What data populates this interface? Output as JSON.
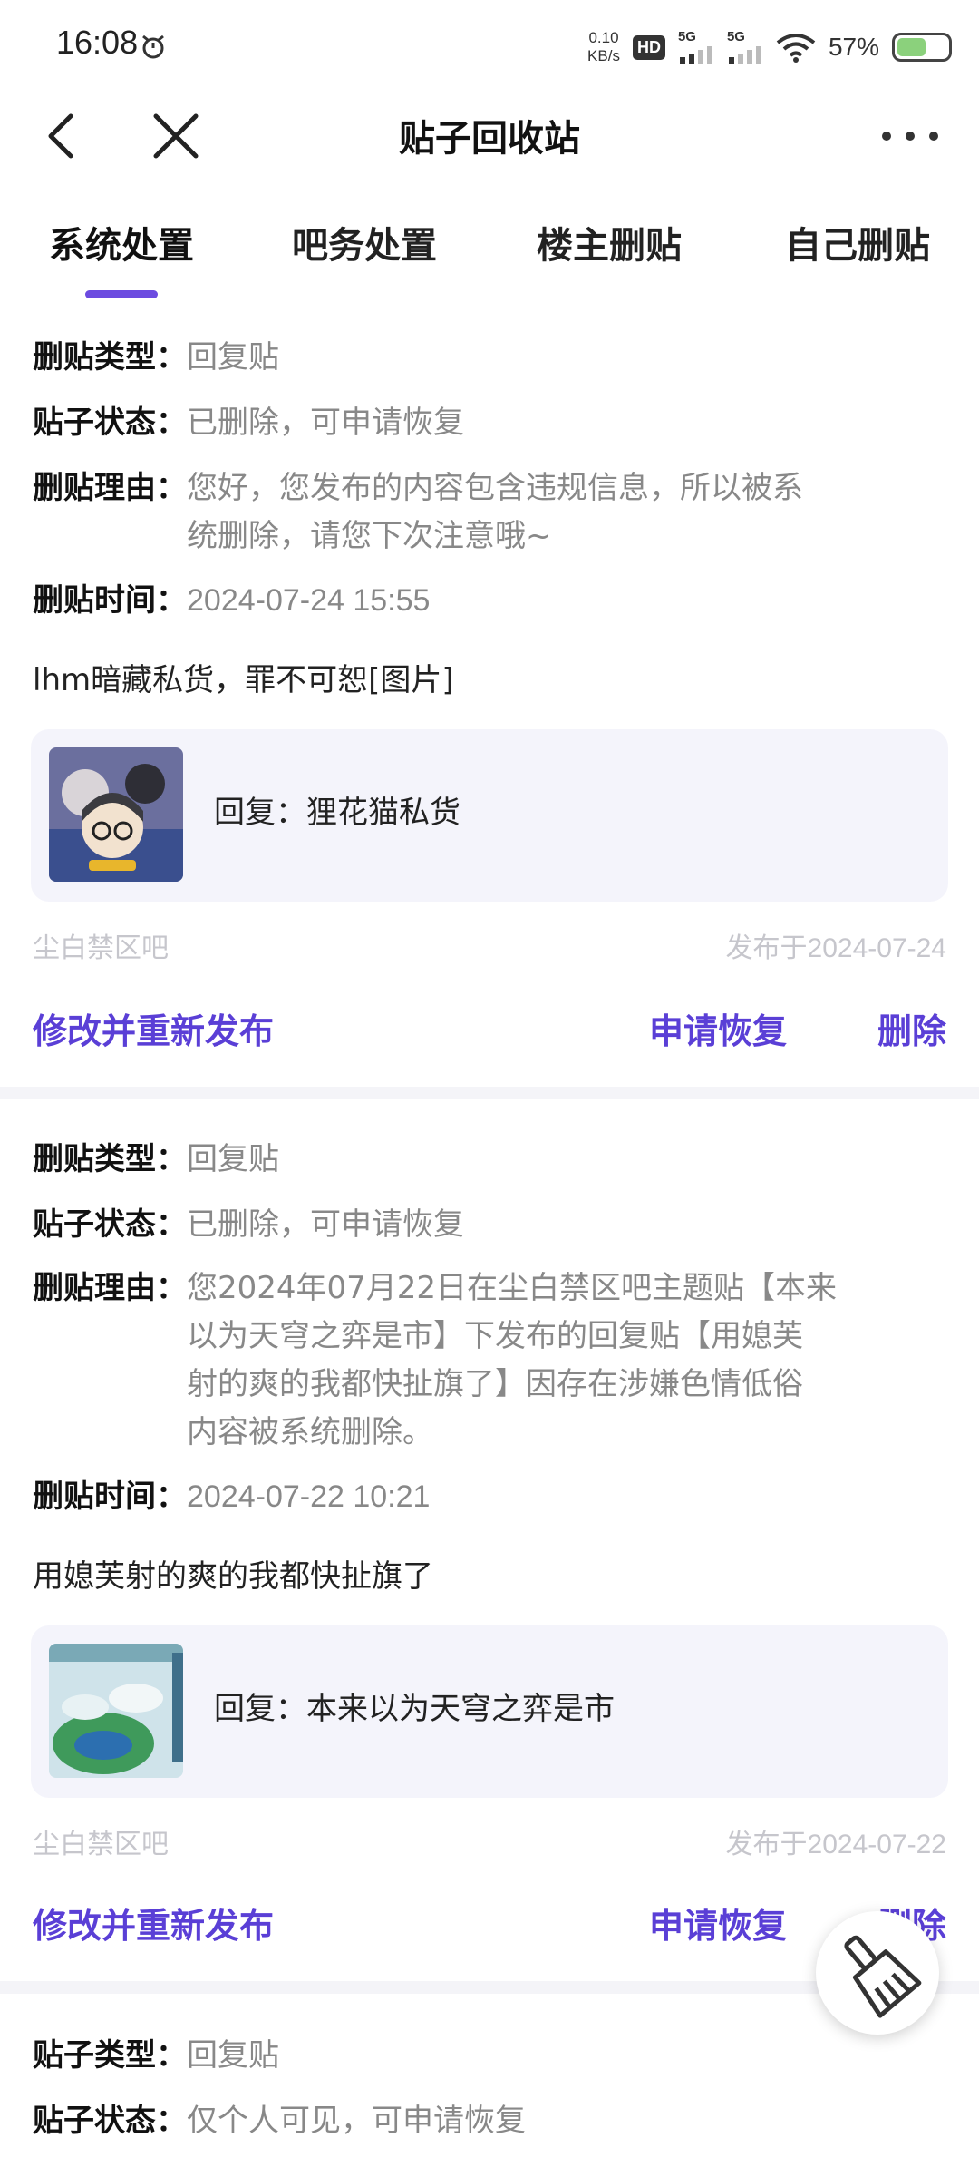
{
  "status_bar": {
    "time": "16:08",
    "net_speed_value": "0.10",
    "net_speed_unit": "KB/s",
    "hd_label": "HD",
    "sim1": "5G",
    "sim2": "5G",
    "battery_pct": "57%"
  },
  "header": {
    "title": "贴子回收站"
  },
  "tabs": [
    {
      "label": "系统处置",
      "active": true
    },
    {
      "label": "吧务处置",
      "active": false
    },
    {
      "label": "楼主删贴",
      "active": false
    },
    {
      "label": "自己删贴",
      "active": false
    }
  ],
  "cards": [
    {
      "type_key": "删贴类型：",
      "type_val": "回复贴",
      "status_key": "贴子状态：",
      "status_val": "已删除，可申请恢复",
      "reason_key": "删贴理由：",
      "reason_line1": "您好，您发布的内容包含违规信息，所以被系",
      "reason_line2": "统删除，请您下次注意哦~",
      "time_key": "删贴时间：",
      "time_val": "2024-07-24 15:55",
      "post_text": "lhm暗藏私货，罪不可恕[图片]",
      "quote": "回复：狸花猫私货",
      "bar_name": "尘白禁区吧",
      "pub_date": "发布于2024-07-24",
      "action_edit": "修改并重新发布",
      "action_restore": "申请恢复",
      "action_delete": "删除"
    },
    {
      "type_key": "删贴类型：",
      "type_val": "回复贴",
      "status_key": "贴子状态：",
      "status_val": "已删除，可申请恢复",
      "reason_key": "删贴理由：",
      "reason_line1": "您2024年07月22日在尘白禁区吧主题贴【本来",
      "reason_line2": "以为天穹之弈是市】下发布的回复贴【用媳芙",
      "reason_line3": "射的爽的我都快扯旗了】因存在涉嫌色情低俗",
      "reason_line4": "内容被系统删除。",
      "time_key": "删贴时间：",
      "time_val": "2024-07-22 10:21",
      "post_text": "用媳芙射的爽的我都快扯旗了",
      "quote": "回复：本来以为天穹之弈是市",
      "bar_name": "尘白禁区吧",
      "pub_date": "发布于2024-07-22",
      "action_edit": "修改并重新发布",
      "action_restore": "申请恢复",
      "action_delete": "删除"
    },
    {
      "type_key": "贴子类型：",
      "type_val": "回复贴",
      "status_key": "贴子状态：",
      "status_val": "仅个人可见，可申请恢复"
    }
  ],
  "colors": {
    "accent": "#5a3fd6",
    "tab_indicator": "#6c4be0",
    "quote_bg": "#f4f4fb"
  },
  "icons": {
    "back": "chevron-left-icon",
    "close": "close-icon",
    "more": "more-dots-icon",
    "fab": "broom-icon"
  }
}
